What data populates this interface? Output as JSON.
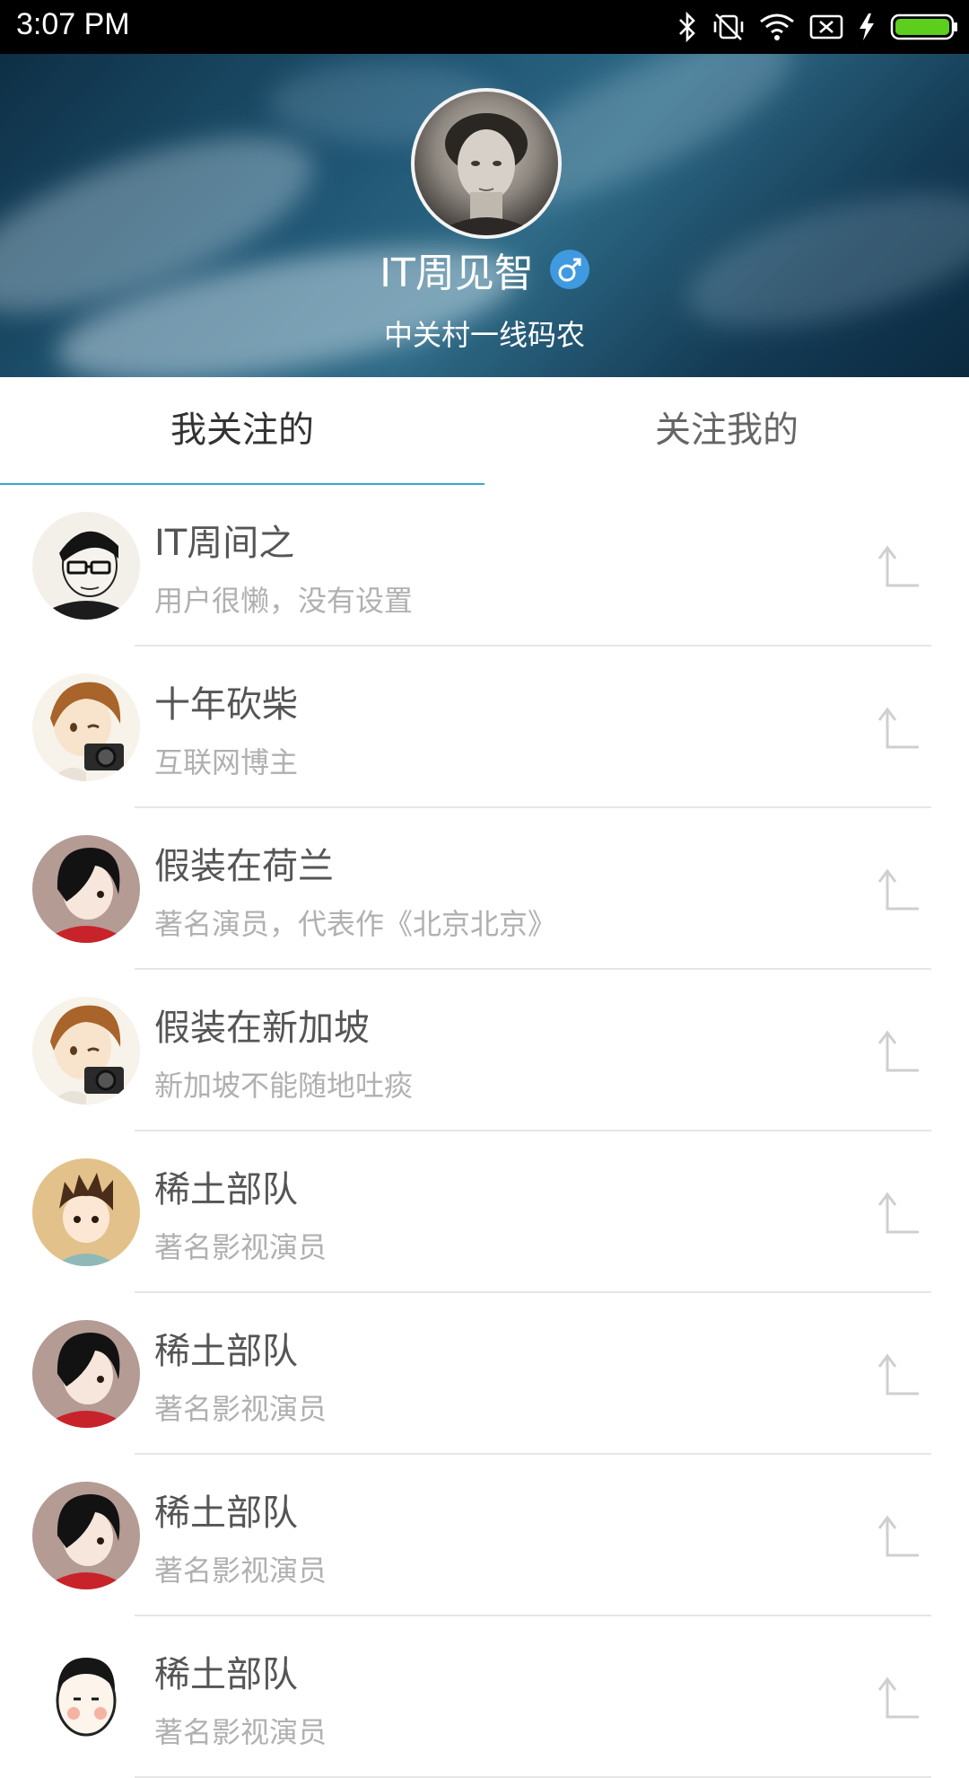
{
  "status_bar": {
    "time": "3:07 PM",
    "icons": [
      "bluetooth-icon",
      "vibrate-off-icon",
      "wifi-icon",
      "no-sim-icon",
      "charging-icon",
      "battery-icon"
    ],
    "battery_color": "#5ccf1e"
  },
  "profile": {
    "name": "IT周见智",
    "gender_symbol": "♂",
    "bio": "中关村一线码农",
    "accent_color": "#3f9ae0"
  },
  "tabs": [
    {
      "label": "我关注的",
      "selected": true
    },
    {
      "label": "关注我的",
      "selected": false
    }
  ],
  "tab_indicator_color": "#3fa3d8",
  "users": [
    {
      "name": "IT周间之",
      "desc": "用户很懒，没有设置",
      "avatar": "glasses-man-avatar"
    },
    {
      "name": "十年砍柴",
      "desc": "互联网博主",
      "avatar": "camera-boy-avatar"
    },
    {
      "name": "假装在荷兰",
      "desc": "著名演员，代表作《北京北京》",
      "avatar": "dark-hair-boy-avatar"
    },
    {
      "name": "假装在新加坡",
      "desc": "新加坡不能随地吐痰",
      "avatar": "camera-boy-avatar"
    },
    {
      "name": "稀土部队",
      "desc": "著名影视演员",
      "avatar": "spiky-hair-boy-avatar"
    },
    {
      "name": "稀土部队",
      "desc": "著名影视演员",
      "avatar": "dark-hair-boy-avatar"
    },
    {
      "name": "稀土部队",
      "desc": "著名影视演员",
      "avatar": "dark-hair-boy-avatar"
    },
    {
      "name": "稀土部队",
      "desc": "著名影视演员",
      "avatar": "cartoon-man-avatar"
    }
  ]
}
